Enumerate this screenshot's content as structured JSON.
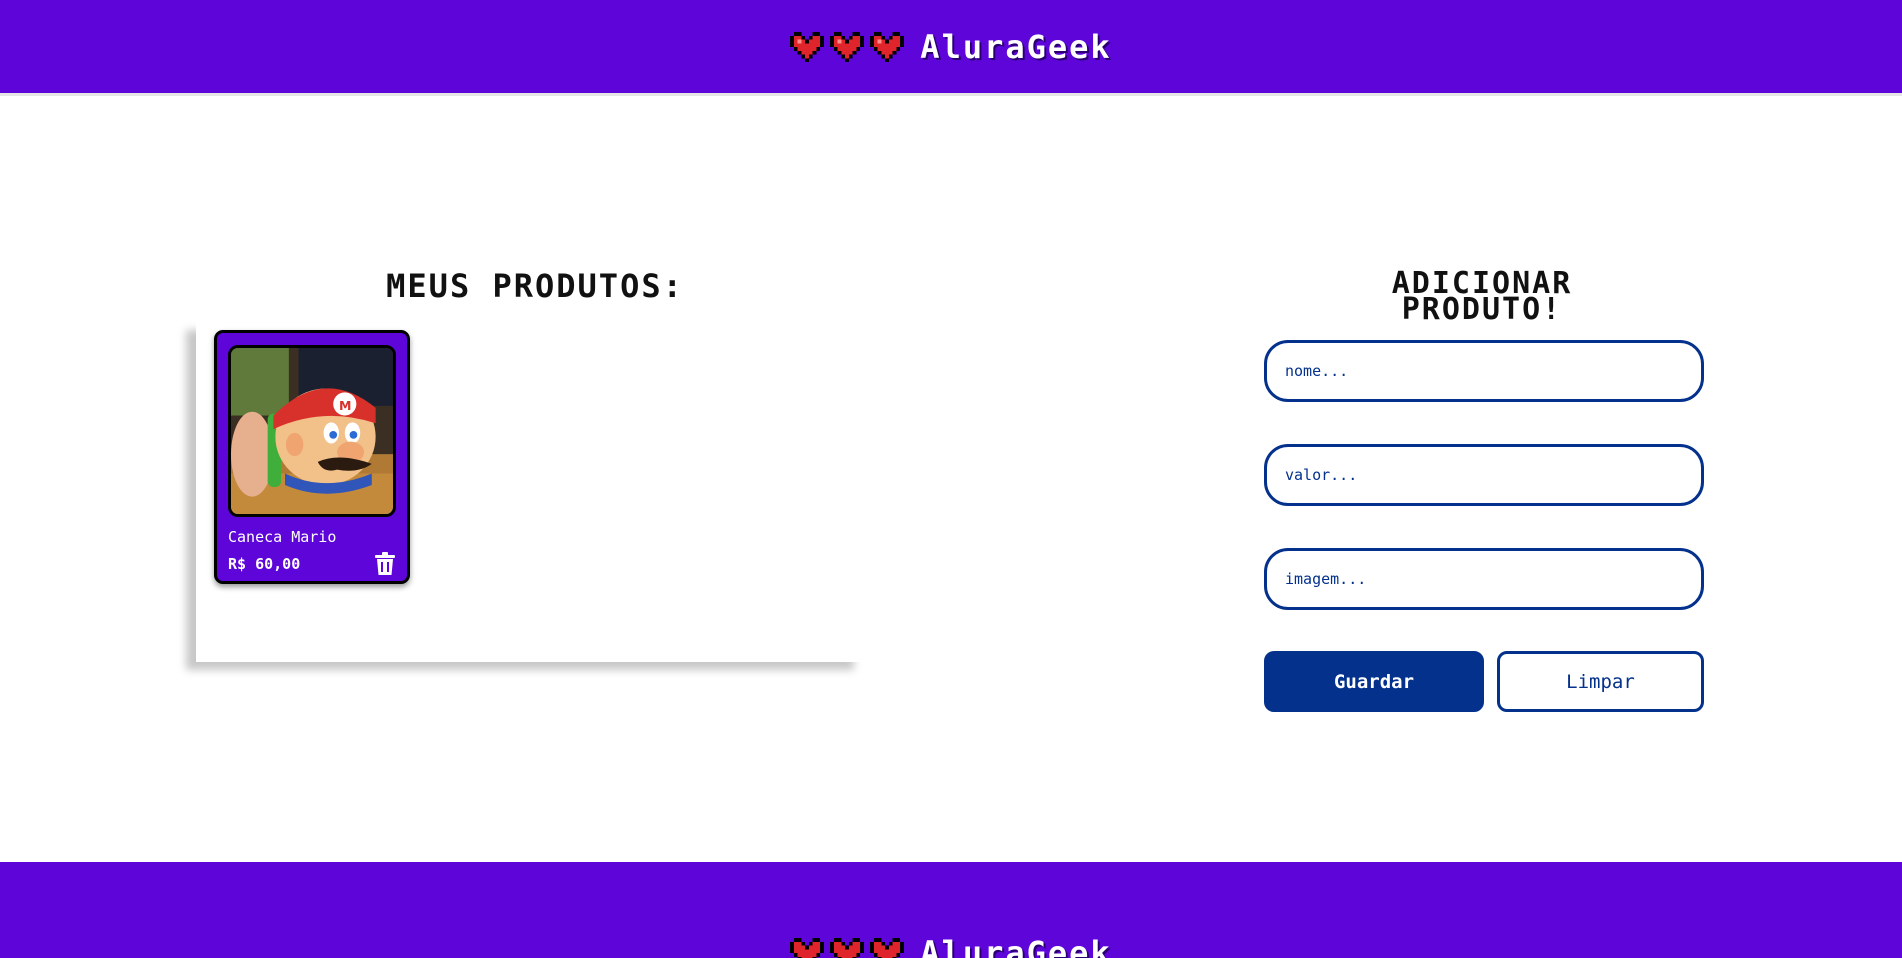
{
  "header": {
    "brand_name": "AluraGeek",
    "hearts": [
      "heart-icon",
      "heart-icon",
      "heart-icon"
    ]
  },
  "products": {
    "title": "MEUS PRODUTOS:",
    "items": [
      {
        "name": "Caneca Mario",
        "price": "R$ 60,00",
        "image": "mario-mug-photo",
        "delete_icon": "trash-icon"
      }
    ]
  },
  "form": {
    "title_line1": "ADICIONAR",
    "title_line2": "PRODUTO!",
    "name_placeholder": "nome...",
    "value_placeholder": "valor...",
    "image_placeholder": "imagem...",
    "save_label": "Guardar",
    "clear_label": "Limpar"
  },
  "footer": {
    "brand_name": "AluraGeek"
  },
  "colors": {
    "brand_purple": "#5e06d9",
    "form_blue": "#03318c",
    "heart_red": "#e0242b",
    "background": "#ffffff"
  }
}
